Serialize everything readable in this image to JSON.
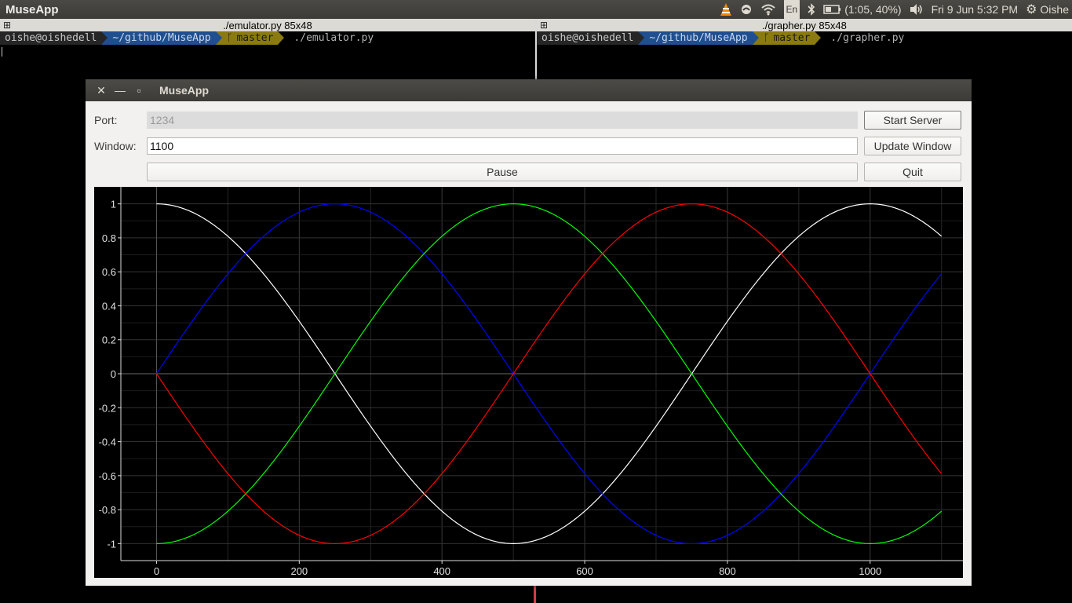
{
  "topbar": {
    "app_title": "MuseApp",
    "lang": "En",
    "battery": "(1:05, 40%)",
    "datetime": "Fri 9 Jun  5:32 PM",
    "user": "Oishe"
  },
  "terminals": [
    {
      "title": "./emulator.py 85x48",
      "user": "oishe@oishedell",
      "dir": "~/github/MuseApp",
      "branch": "master",
      "command": "./emulator.py"
    },
    {
      "title": "./grapher.py 85x48",
      "user": "oishe@oishedell",
      "dir": "~/github/MuseApp",
      "branch": "master",
      "command": "./grapher.py"
    }
  ],
  "window": {
    "title": "MuseApp",
    "port_label": "Port:",
    "port_value": "1234",
    "window_label": "Window:",
    "window_value": "1100",
    "start_server": "Start Server",
    "update_window": "Update Window",
    "pause": "Pause",
    "quit": "Quit"
  },
  "chart_data": {
    "type": "line",
    "xlim": [
      -50,
      1130
    ],
    "ylim": [
      -1.1,
      1.1
    ],
    "grid": true,
    "x_ticks": [
      0,
      200,
      400,
      600,
      800,
      1000
    ],
    "y_ticks": [
      1,
      0.8,
      0.6,
      0.4,
      0.2,
      0,
      -0.2,
      -0.4,
      -0.6,
      -0.8,
      -1
    ],
    "y_tick_labels": [
      "1",
      "0.8",
      "0.6",
      "0.4",
      "0.2",
      "0",
      "-0.2",
      "-0.4",
      "-0.6",
      "-0.8",
      "-1"
    ],
    "x_range": [
      0,
      1100
    ],
    "period": 1000,
    "series": [
      {
        "color": "#ffffff",
        "function": "cos",
        "phase_x": 0
      },
      {
        "color": "#0000ff",
        "function": "cos",
        "phase_x": 250
      },
      {
        "color": "#00ff00",
        "function": "cos",
        "phase_x": 500
      },
      {
        "color": "#ff0000",
        "function": "cos",
        "phase_x": 750
      }
    ]
  }
}
